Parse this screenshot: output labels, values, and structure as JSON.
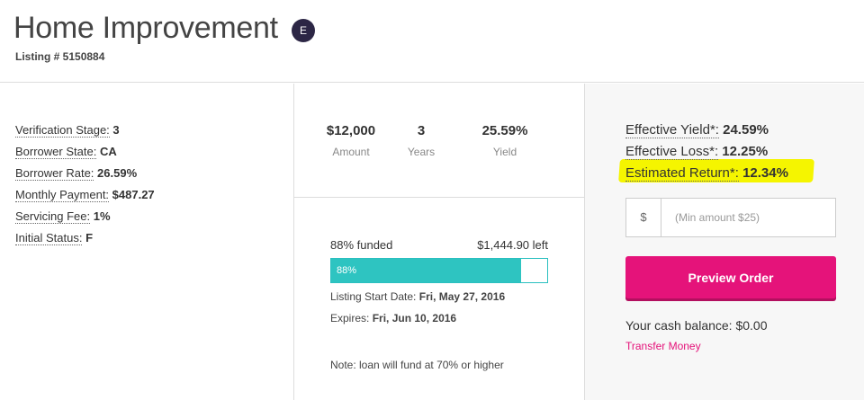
{
  "header": {
    "title": "Home Improvement",
    "grade": "E",
    "listing_label": "Listing # 5150884"
  },
  "details": [
    {
      "label": "Verification Stage:",
      "value": "3"
    },
    {
      "label": "Borrower State:",
      "value": "CA"
    },
    {
      "label": "Borrower Rate:",
      "value": "26.59%"
    },
    {
      "label": "Monthly Payment:",
      "value": "$487.27"
    },
    {
      "label": "Servicing Fee:",
      "value": "1%"
    },
    {
      "label": "Initial Status:",
      "value": "F"
    }
  ],
  "stats": {
    "amount": {
      "value": "$12,000",
      "label": "Amount"
    },
    "years": {
      "value": "3",
      "label": "Years"
    },
    "yield": {
      "value": "25.59%",
      "label": "Yield"
    }
  },
  "funding": {
    "funded_text": "88% funded",
    "left_text": "$1,444.90 left",
    "percent": 88,
    "bar_label": "88%",
    "start_label": "Listing Start Date:",
    "start_value": "Fri, May 27, 2016",
    "expires_label": "Expires:",
    "expires_value": "Fri, Jun 10, 2016",
    "note": "Note: loan will fund at 70% or higher"
  },
  "returns": {
    "effective_yield": {
      "label": "Effective Yield*:",
      "value": "24.59%"
    },
    "effective_loss": {
      "label": "Effective Loss*:",
      "value": "12.25%"
    },
    "estimated_return": {
      "label": "Estimated Return*:",
      "value": "12.34%"
    }
  },
  "order": {
    "currency_symbol": "$",
    "amount_placeholder": "(Min amount $25)",
    "preview_label": "Preview Order",
    "cash_balance": "Your cash balance: $0.00",
    "transfer_label": "Transfer Money"
  },
  "colors": {
    "accent": "#e5137a",
    "progress": "#2ec4c1",
    "highlight": "#f5f500",
    "grade_badge": "#2c2645"
  }
}
